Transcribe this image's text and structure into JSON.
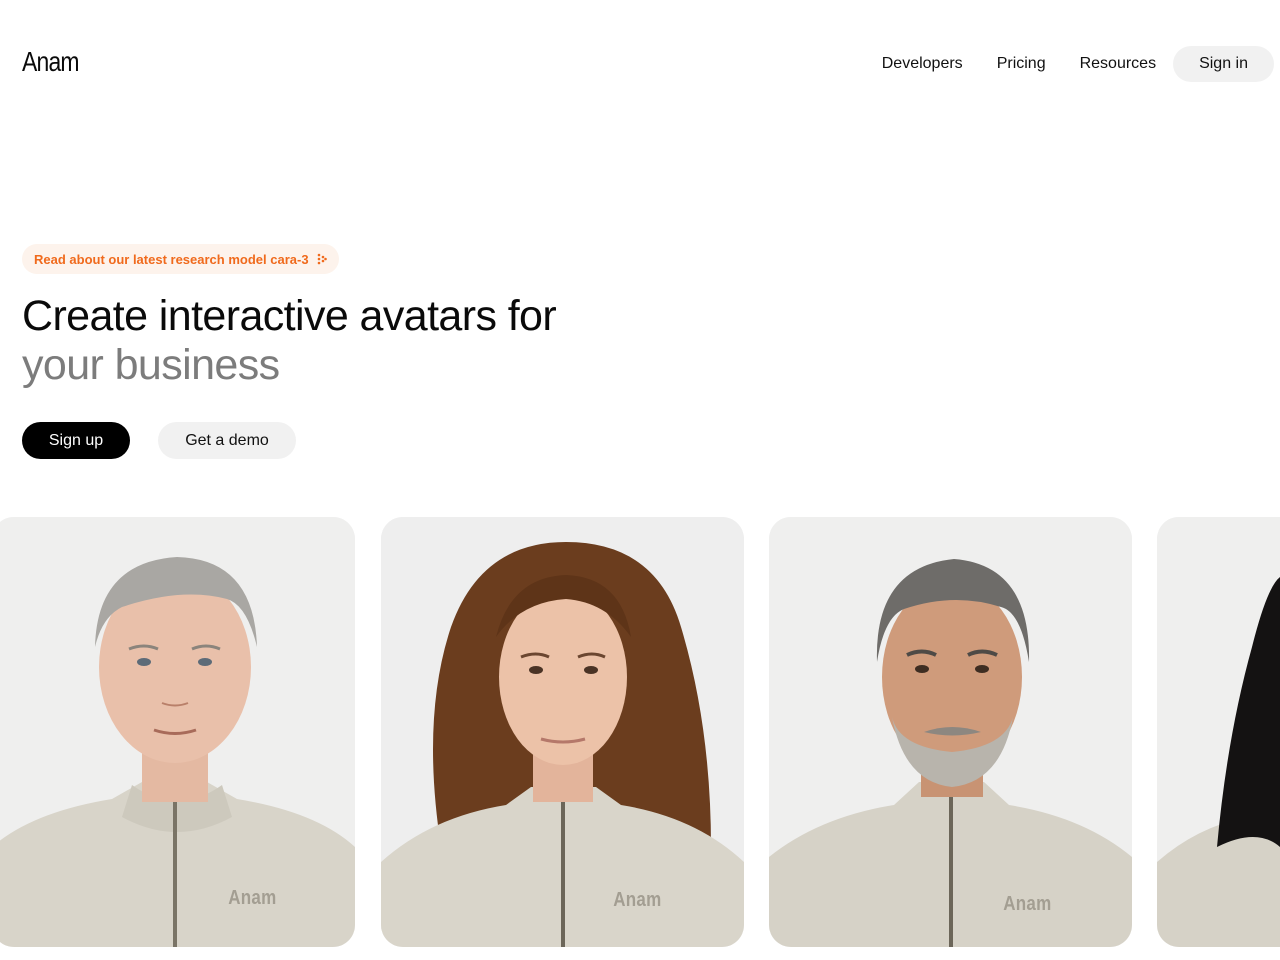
{
  "brand": {
    "name": "Anam"
  },
  "nav": {
    "links": [
      "Developers",
      "Pricing",
      "Resources"
    ],
    "signin_label": "Sign in"
  },
  "hero": {
    "announcement": "Read about our latest research model cara-3",
    "headline_line1": "Create interactive avatars for",
    "headline_line2": "your business",
    "primary_cta": "Sign up",
    "secondary_cta": "Get a demo"
  },
  "avatars": [
    {
      "description": "grey-haired man",
      "sweater_logo": "Anam"
    },
    {
      "description": "curly-haired woman",
      "sweater_logo": "Anam"
    },
    {
      "description": "bearded man",
      "sweater_logo": "Anam"
    },
    {
      "description": "dark-haired woman (partially visible)",
      "sweater_logo": ""
    }
  ],
  "colors": {
    "accent": "#f06a1c",
    "pill_bg": "#fdf3ec",
    "headline_muted": "#7c7c7c",
    "button_dark": "#000000",
    "button_light": "#f1f1f1"
  }
}
